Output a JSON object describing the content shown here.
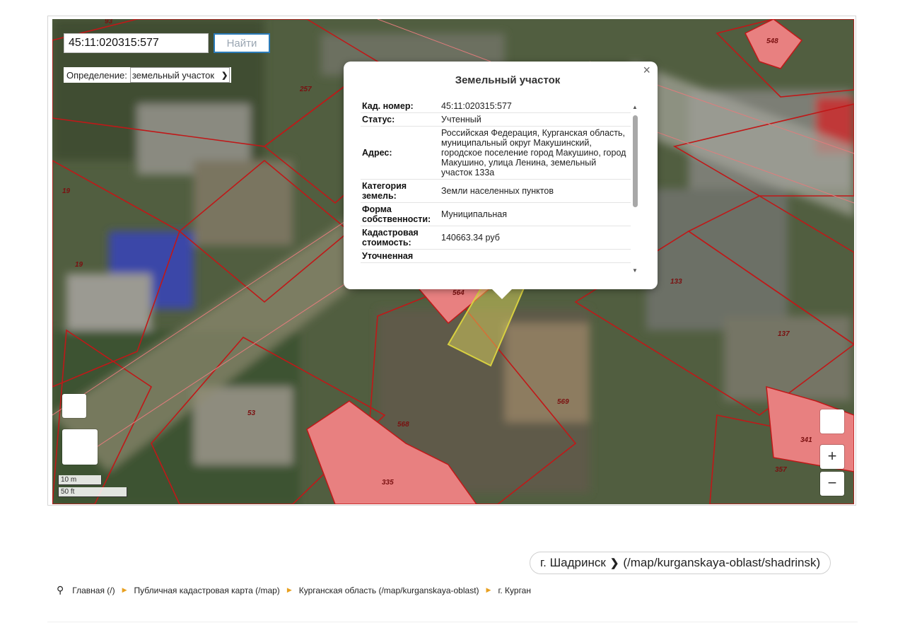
{
  "search": {
    "value": "45:11:020315:577",
    "button_label": "Найти"
  },
  "definition": {
    "label": "Определение:",
    "selected": "земельный участок"
  },
  "popup": {
    "title": "Земельный участок",
    "close_glyph": "×",
    "rows": [
      {
        "key": "Кад. номер:",
        "value": "45:11:020315:577"
      },
      {
        "key": "Статус:",
        "value": "Учтенный"
      },
      {
        "key": "Адрес:",
        "value": "Российская Федерация, Курганская область, муниципальный округ Макушинский, городское поселение город Макушино, город Макушино, улица Ленина, земельный участок 133а"
      },
      {
        "key": "Категория земель:",
        "value": "Земли населенных пунктов"
      },
      {
        "key": "Форма собственности:",
        "value": "Муниципальная"
      },
      {
        "key": "Кадастровая стоимость:",
        "value": "140663.34 руб"
      },
      {
        "key": "Уточненная",
        "value": ""
      }
    ]
  },
  "map_labels": [
    "93",
    "548",
    "257",
    "19",
    "19",
    "133",
    "137",
    "564",
    "569",
    "53",
    "568",
    "335",
    "341",
    "357"
  ],
  "zoom": {
    "in": "+",
    "out": "−"
  },
  "scale": {
    "metric": "10 m",
    "imperial": "50 ft"
  },
  "next_city": {
    "label": "г. Шадринск",
    "chevron": "❯",
    "path": "(/map/kurganskaya-oblast/shadrinsk)"
  },
  "breadcrumbs": [
    "Главная (/)",
    "Публичная кадастровая карта (/map)",
    "Курганская область (/map/kurganskaya-oblast)",
    "г. Курган"
  ],
  "colors": {
    "parcel_fill": "#e88080",
    "parcel_border": "#c01818",
    "selected_fill": "#e8e060",
    "accent_button": "#2b7bb9",
    "crumb_separator": "#e8a020"
  }
}
